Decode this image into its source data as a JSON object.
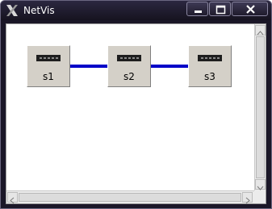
{
  "window": {
    "title": "NetVis",
    "app_icon": "x-logo-icon",
    "controls": {
      "minimize": "minimize-icon",
      "maximize": "maximize-icon",
      "close": "close-icon"
    }
  },
  "network": {
    "link_color": "#0000c8",
    "nodes": [
      {
        "label": "s1",
        "icon": "switch-port-icon"
      },
      {
        "label": "s2",
        "icon": "switch-port-icon"
      },
      {
        "label": "s3",
        "icon": "switch-port-icon"
      }
    ],
    "links": [
      {
        "from": "s1",
        "to": "s2"
      },
      {
        "from": "s2",
        "to": "s3"
      }
    ]
  },
  "scrollbars": {
    "up_icon": "arrow-up-icon",
    "down_icon": "arrow-down-icon",
    "left_icon": "arrow-left-icon",
    "right_icon": "arrow-right-icon"
  }
}
